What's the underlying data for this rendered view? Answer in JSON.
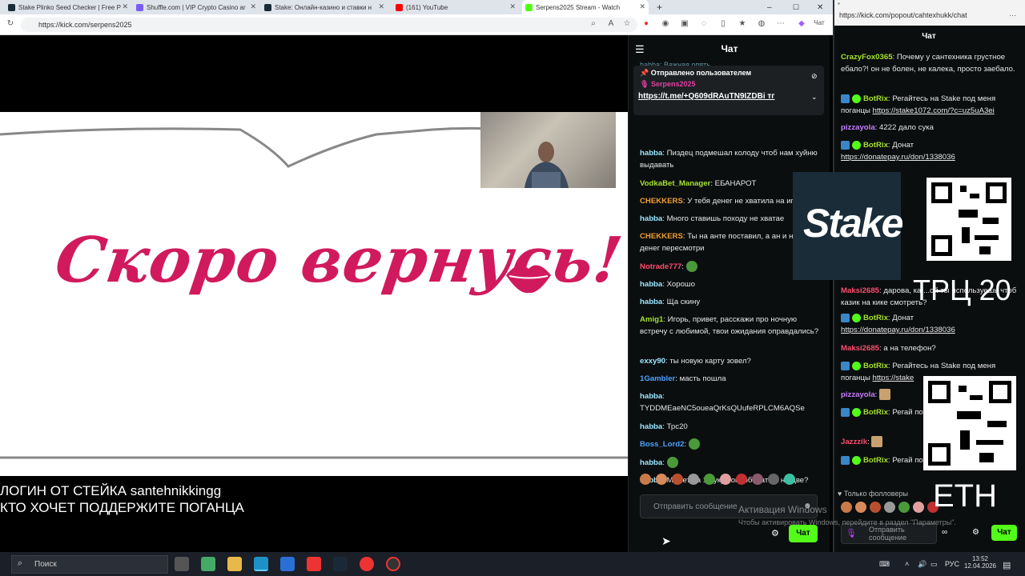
{
  "browser": {
    "tabs": [
      {
        "title": "Stake Plinko Seed Checker | Free P",
        "color": "#1a2c38"
      },
      {
        "title": "Shuffle.com | VIP Crypto Casino ar",
        "color": "#7b5cff"
      },
      {
        "title": "Stake: Онлайн-казино и ставки н",
        "color": "#1a2c38"
      },
      {
        "title": "(161) YouTube",
        "color": "#ff0000"
      },
      {
        "title": "Serpens2025 Stream - Watch",
        "color": "#53fc18"
      }
    ],
    "url": "https://kick.com/serpens2025",
    "chat_btn": "Чат"
  },
  "stream": {
    "slide_text": "Скоро вернусь!",
    "bottom_line1": "ЛОГИН ОТ СТЕЙКА santehnikkingg",
    "bottom_line2": "КТО ХОЧЕТ ПОДДЕРЖИТЕ ПОГАНЦА"
  },
  "chat": {
    "title": "Чат",
    "pinned_header": "Отправлено пользователем",
    "pinned_user": "Serpens2025",
    "pinned_link": "https://t.me/+Q609dRAuTN9IZDBi тг",
    "cut_user": "habba",
    "cut_text": "Важная опять",
    "messages": [
      {
        "user": "habba",
        "color": "#9be7ff",
        "text": "Пиздец подмешал колоду чтоб нам хуйню выдавать"
      },
      {
        "user": "VodkaBet_Manager",
        "color": "#a6e22e",
        "text": "ЕБАНАРОТ"
      },
      {
        "user": "CHEKKERS",
        "color": "#f0a030",
        "text": "У тебя денег не хватила на игру"
      },
      {
        "user": "habba",
        "color": "#9be7ff",
        "text": "Много ставишь походу не хватае"
      },
      {
        "user": "CHEKKERS",
        "color": "#f0a030",
        "text": "Ты на анте поставил, а ан и небыло денег пересмотри"
      },
      {
        "user": "Notrade777",
        "color": "#ff4d6d",
        "text": ""
      },
      {
        "user": "habba",
        "color": "#9be7ff",
        "text": "Хорошо"
      },
      {
        "user": "habba",
        "color": "#9be7ff",
        "text": "Ща скину"
      },
      {
        "user": "Amig1",
        "color": "#a6e22e",
        "text": "Игорь, привет, расскажи про ночную встречу с любимой, твои ожидания оправдались?"
      },
      {
        "user": "exxy90",
        "color": "#9be7ff",
        "text": "ты новую карту зовел?"
      },
      {
        "user": "1Gambler",
        "color": "#4da3ff",
        "text": "масть пошла"
      },
      {
        "user": "habba",
        "color": "#9be7ff",
        "text": "TYDDMEaeNC5oueaQrKsQUufeRPLCM6AQSe"
      },
      {
        "user": "habba",
        "color": "#9be7ff",
        "text": "Трс20"
      },
      {
        "user": "Boss_Lord2",
        "color": "#4da3ff",
        "text": ""
      },
      {
        "user": "habba",
        "color": "#9be7ff",
        "text": ""
      },
      {
        "user": "habba",
        "color": "#9be7ff",
        "text": "Может на 1 руку попробовать а не две?"
      }
    ],
    "input_placeholder": "Отправить сообщение",
    "send_label": "Чат"
  },
  "popout": {
    "url": "https://kick.com/popout/cahtexhukk/chat",
    "title": "Чат",
    "messages": [
      {
        "user": "CrazyFox0365",
        "color": "#a6e22e",
        "text": "Почему у сантехника грустное ебало?! он не болен, не калека, просто заебало."
      },
      {
        "user": "BotRix",
        "color": "#a6e22e",
        "bot": true,
        "text": "Регайтесь на Stake под меня поганцы ",
        "link": "https://stake1072.com/?c=uz5uA3ei"
      },
      {
        "user": "pizzayola",
        "color": "#c77dff",
        "text": "4222 дало сука"
      },
      {
        "user": "BotRix",
        "color": "#a6e22e",
        "bot": true,
        "text": "Донат ",
        "link": "https://donatepay.ru/don/1338036"
      },
      {
        "user": "Maksi2685",
        "color": "#ff4d6d",
        "text": "дарова, ка ...ой ты используешь чтоб казик на кике смотреть?"
      },
      {
        "user": "BotRix",
        "color": "#a6e22e",
        "bot": true,
        "text": "Донат ",
        "link": "https://donatepay.ru/don/1338036"
      },
      {
        "user": "Maksi2685",
        "color": "#ff4d6d",
        "text": "а на телефон?"
      },
      {
        "user": "BotRix",
        "color": "#a6e22e",
        "bot": true,
        "text": "Регайтесь на Stake под меня поганцы ",
        "link": "https://stake"
      },
      {
        "user": "pizzayola",
        "color": "#c77dff",
        "text": ""
      },
      {
        "user": "BotRix",
        "color": "#a6e22e",
        "bot": true,
        "text": "Регай поганцы ",
        "link": "https://stake"
      },
      {
        "user": "Jazzzik",
        "color": "#ff4d6d",
        "text": ""
      },
      {
        "user": "BotRix",
        "color": "#a6e22e",
        "bot": true,
        "text": "Регай поганцы ",
        "link": "https://stake"
      }
    ],
    "followers_only": "Только фолловеры",
    "input_placeholder": "Отправить сообщение",
    "send_label": "Чат"
  },
  "overlay": {
    "stake_logo": "Stake",
    "trc_label": "ТРЦ 20",
    "eth_label": "ETH",
    "watermark_title": "Активация Windows",
    "watermark_sub": "Чтобы активировать Windows, перейдите в раздел \"Параметры\"."
  },
  "taskbar": {
    "search": "Поиск",
    "lang": "РУС",
    "time": "13:52",
    "date": "12.04.2026"
  }
}
